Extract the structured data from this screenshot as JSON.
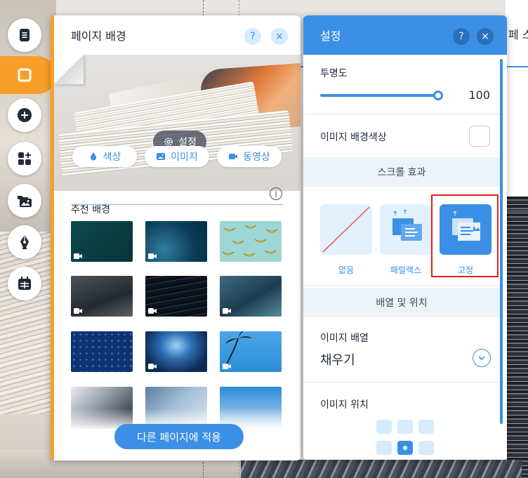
{
  "page_title_fragment": "페 스",
  "toolbar": {
    "items": [
      {
        "name": "pages-icon"
      },
      {
        "name": "background-icon",
        "active": true
      },
      {
        "name": "add-icon"
      },
      {
        "name": "add-apps-icon"
      },
      {
        "name": "media-icon"
      },
      {
        "name": "blog-pen-icon"
      },
      {
        "name": "bookings-calendar-icon"
      }
    ]
  },
  "page_background_panel": {
    "title": "페이지 배경",
    "help": "?",
    "close": "×",
    "settings_label": "설정",
    "type_buttons": {
      "color": "색상",
      "image": "이미지",
      "video": "동영상"
    },
    "recommended_title": "추천 배경",
    "info": "i",
    "apply_button": "다른 페이지에 적용"
  },
  "settings_panel": {
    "title": "설정",
    "help": "?",
    "close": "×",
    "opacity_label": "투명도",
    "opacity_value": "100",
    "bg_color_label": "이미지 배경색상",
    "scroll_effect_title": "스크롤 효과",
    "effects": {
      "none": "없음",
      "parallax": "패럴랙스",
      "fixed": "고정"
    },
    "selected_effect": "fixed",
    "layout_title": "배열 및 위치",
    "image_layout_label": "이미지 배열",
    "image_layout_value": "채우기",
    "image_position_label": "이미지 위치",
    "selected_position": "bottom-center"
  },
  "colors": {
    "accent": "#3b8fe5",
    "toolbar_active": "#f79f29",
    "highlight_box": "#e0201e"
  }
}
